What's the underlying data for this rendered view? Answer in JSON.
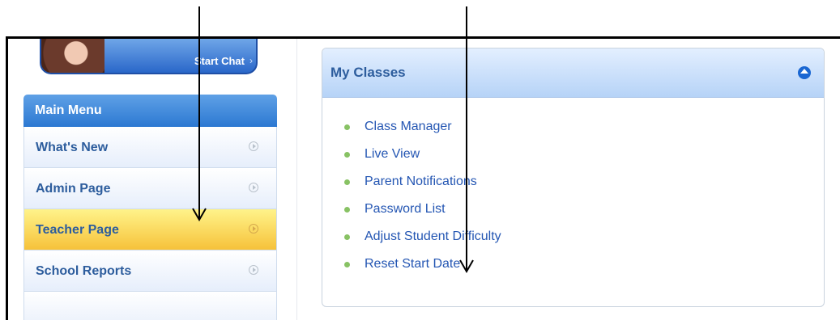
{
  "chat": {
    "label": "Start Chat",
    "chevron": "›"
  },
  "menu": {
    "header": "Main Menu",
    "items": [
      {
        "label": "What's New"
      },
      {
        "label": "Admin Page"
      },
      {
        "label": "Teacher Page",
        "active": true
      },
      {
        "label": "School Reports"
      }
    ]
  },
  "panel": {
    "title": "My Classes",
    "links": [
      "Class Manager",
      "Live View",
      "Parent Notifications",
      "Password List",
      "Adjust Student Difficulty",
      "Reset Start Date"
    ]
  },
  "colors": {
    "accent": "#2c78d2",
    "active_item": "#f6c23a",
    "link": "#2456b3",
    "bullet": "#88c264"
  }
}
